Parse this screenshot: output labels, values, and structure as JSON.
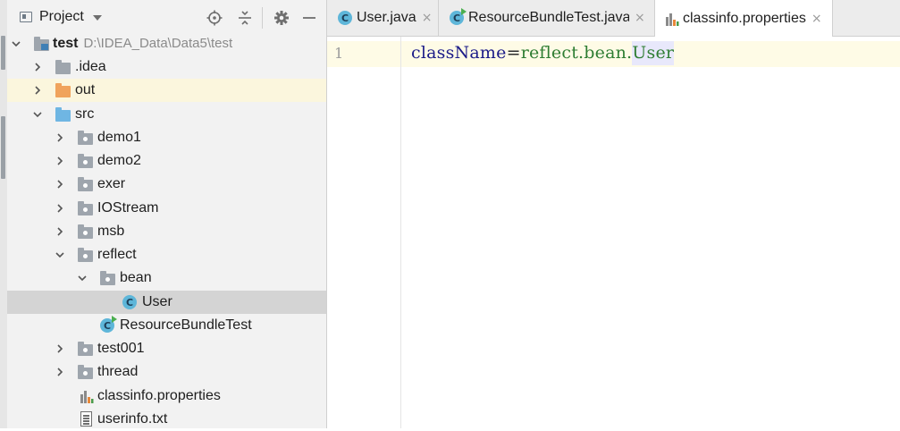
{
  "project_panel": {
    "title": "Project"
  },
  "tree": {
    "root": {
      "label": "test",
      "path": "D:\\IDEA_Data\\Data5\\test"
    },
    "items": [
      {
        "label": ".idea"
      },
      {
        "label": "out"
      },
      {
        "label": "src"
      },
      {
        "label": "demo1"
      },
      {
        "label": "demo2"
      },
      {
        "label": "exer"
      },
      {
        "label": "IOStream"
      },
      {
        "label": "msb"
      },
      {
        "label": "reflect"
      },
      {
        "label": "bean"
      },
      {
        "label": "User"
      },
      {
        "label": "ResourceBundleTest"
      },
      {
        "label": "test001"
      },
      {
        "label": "thread"
      },
      {
        "label": "classinfo.properties"
      },
      {
        "label": "userinfo.txt"
      }
    ]
  },
  "editor": {
    "tabs": [
      {
        "label": "User.java",
        "close": "×"
      },
      {
        "label": "ResourceBundleTest.java",
        "close": "×"
      },
      {
        "label": "classinfo.properties",
        "close": "×"
      }
    ],
    "line_number": "1",
    "code": {
      "key": "className",
      "equals": "=",
      "value_pre": "reflect.bean.",
      "value_hl": "User"
    }
  },
  "colors": {
    "selection": "#d4d4d4",
    "excluded_highlight": "#fbf6dd",
    "current_line": "#fefbe6",
    "code_key": "#1b1b88",
    "code_value": "#2e7d32"
  }
}
